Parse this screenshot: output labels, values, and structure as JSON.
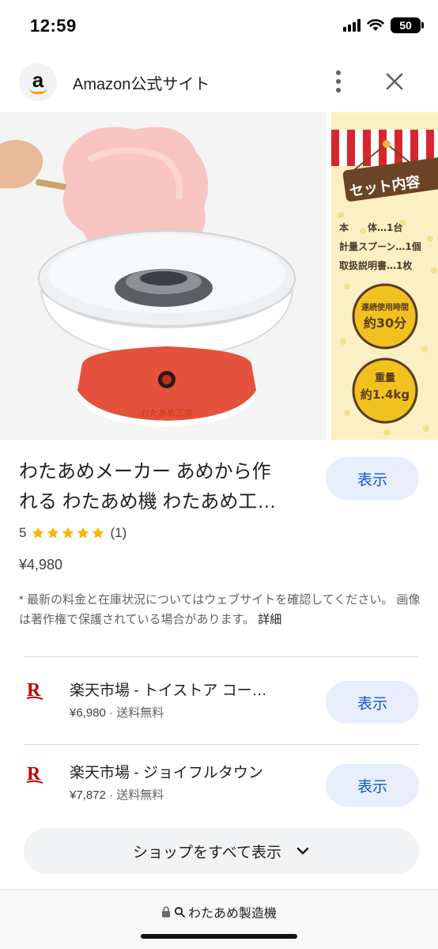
{
  "status_bar": {
    "time": "12:59",
    "battery": "50"
  },
  "header": {
    "site_name": "Amazon公式サイト",
    "logo_letter": "a"
  },
  "gallery": {
    "second_image_lines": [
      "セット内容",
      "本　　体…1台",
      "計量スプーン…1個",
      "取扱説明書…1枚",
      "連続使用時間",
      "約30分",
      "重量",
      "約1.4kg"
    ],
    "product_logo_text": "わたあめ工房"
  },
  "product": {
    "title_line1": "わたあめメーカー あめから作",
    "title_line2": "れる わたあめ機 わたあめ工…",
    "show_label": "表示",
    "rating_value": "5",
    "rating_stars": 5,
    "review_count": "(1)",
    "price": "¥4,980",
    "disclaimer": "* 最新の料金と在庫状況についてはウェブサイトを確認してください。 画像は著作権で保護されている場合があります。",
    "detail_label": "詳細"
  },
  "shops": [
    {
      "name": "楽天市場 - トイストア コー…",
      "price": "¥6,980",
      "shipping": "送料無料",
      "button": "表示"
    },
    {
      "name": "楽天市場 - ジョイフルタウン",
      "price": "¥7,872",
      "shipping": "送料無料",
      "button": "表示"
    }
  ],
  "all_shops_label": "ショップをすべて表示",
  "address_bar": {
    "query": "わたあめ製造機"
  },
  "colors": {
    "accent": "#0b57d0",
    "button_bg": "#e8eefc",
    "star": "#f6b704",
    "rakuten": "#bf0000"
  }
}
